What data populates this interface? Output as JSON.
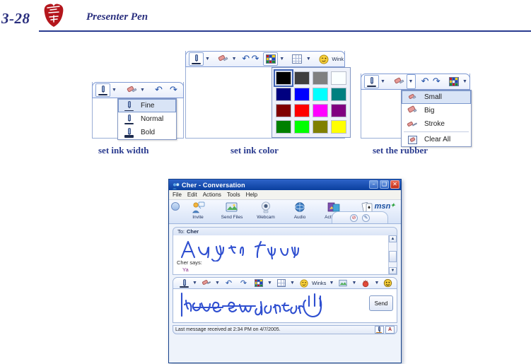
{
  "page": {
    "number": "3-28",
    "title": "Presenter Pen",
    "logo_icon": "red-seal-logo"
  },
  "captions": [
    {
      "text": "set ink width"
    },
    {
      "text": "set ink color"
    },
    {
      "text": "set the rubber"
    }
  ],
  "panel_ink_width": {
    "toolbar": [
      {
        "icon": "pen-icon",
        "selected": true
      },
      {
        "icon": "chevron-down-icon"
      },
      {
        "icon": "eraser-icon"
      },
      {
        "icon": "chevron-down-icon"
      },
      {
        "icon": "undo-icon"
      },
      {
        "icon": "redo-icon"
      }
    ],
    "menu": [
      {
        "label": "Fine",
        "icon": "pen-fine-icon",
        "highlighted": true
      },
      {
        "label": "Normal",
        "icon": "pen-normal-icon",
        "highlighted": false
      },
      {
        "label": "Bold",
        "icon": "pen-bold-icon",
        "highlighted": false
      }
    ]
  },
  "panel_ink_color": {
    "toolbar": [
      {
        "icon": "pen-icon",
        "selected": true
      },
      {
        "icon": "chevron-down-icon"
      },
      {
        "icon": "eraser-icon"
      },
      {
        "icon": "chevron-down-icon"
      },
      {
        "icon": "undo-icon"
      },
      {
        "icon": "redo-icon"
      },
      {
        "icon": "color-palette-icon",
        "selected": true
      },
      {
        "icon": "chevron-down-icon"
      },
      {
        "icon": "grid-icon"
      },
      {
        "icon": "chevron-down-icon"
      },
      {
        "icon": "wink-smiley-icon"
      }
    ],
    "wink_label": "Wink",
    "swatches": [
      {
        "name": "black",
        "hex": "#000000",
        "selected": true
      },
      {
        "name": "dark-gray",
        "hex": "#3f3f3f",
        "selected": false
      },
      {
        "name": "gray",
        "hex": "#808080",
        "selected": false
      },
      {
        "name": "white",
        "hex": "#fbffff",
        "selected": false
      },
      {
        "name": "navy",
        "hex": "#000080",
        "selected": false
      },
      {
        "name": "blue",
        "hex": "#0000ff",
        "selected": false
      },
      {
        "name": "cyan",
        "hex": "#00ffff",
        "selected": false
      },
      {
        "name": "teal",
        "hex": "#008080",
        "selected": false
      },
      {
        "name": "dark-red",
        "hex": "#800000",
        "selected": false
      },
      {
        "name": "red",
        "hex": "#ff0000",
        "selected": false
      },
      {
        "name": "magenta",
        "hex": "#ff00ff",
        "selected": false
      },
      {
        "name": "purple",
        "hex": "#800080",
        "selected": false
      },
      {
        "name": "green",
        "hex": "#008000",
        "selected": false
      },
      {
        "name": "lime",
        "hex": "#00ff00",
        "selected": false
      },
      {
        "name": "olive",
        "hex": "#808000",
        "selected": false
      },
      {
        "name": "yellow",
        "hex": "#ffff00",
        "selected": false
      }
    ]
  },
  "panel_rubber": {
    "toolbar": [
      {
        "icon": "pen-icon",
        "selected": true
      },
      {
        "icon": "chevron-down-icon"
      },
      {
        "icon": "eraser-icon"
      },
      {
        "icon": "chevron-down-icon",
        "selected": true
      },
      {
        "icon": "undo-icon"
      },
      {
        "icon": "redo-icon"
      },
      {
        "icon": "color-palette-icon"
      },
      {
        "icon": "chevron-down-icon"
      }
    ],
    "menu": [
      {
        "label": "Small",
        "icon": "eraser-small-icon",
        "highlighted": true
      },
      {
        "label": "Big",
        "icon": "eraser-big-icon",
        "highlighted": false
      },
      {
        "label": "Stroke",
        "icon": "eraser-stroke-icon",
        "highlighted": false
      },
      {
        "label": "Clear All",
        "icon": "clear-all-icon",
        "highlighted": false
      }
    ]
  },
  "messenger": {
    "title": "Cher - Conversation",
    "title_icon": "messenger-contact-icon",
    "window_buttons": [
      {
        "name": "minimize",
        "glyph": "–"
      },
      {
        "name": "maximize",
        "glyph": "❑"
      },
      {
        "name": "close",
        "glyph": "✕"
      }
    ],
    "menu": [
      "File",
      "Edit",
      "Actions",
      "Tools",
      "Help"
    ],
    "toolbar": [
      {
        "label": "Invite",
        "icon": "invite-icon"
      },
      {
        "label": "Send Files",
        "icon": "send-files-icon"
      },
      {
        "label": "Webcam",
        "icon": "webcam-icon"
      },
      {
        "label": "Audio",
        "icon": "audio-icon"
      },
      {
        "label": "Activities",
        "icon": "activities-icon"
      },
      {
        "label": "Games",
        "icon": "games-icon"
      }
    ],
    "brand": "msn",
    "tab_icons": [
      {
        "name": "block-icon",
        "glyph": "⊘"
      },
      {
        "name": "pen-tab-icon",
        "glyph": "✎"
      }
    ],
    "to_label": "To:",
    "to_value": "Cher",
    "history_ink_text": "Are You free",
    "says_name": "Cher says:",
    "says_text": "Ya",
    "format_toolbar": [
      {
        "icon": "pen-icon"
      },
      {
        "icon": "chevron-down-icon"
      },
      {
        "icon": "eraser-icon"
      },
      {
        "icon": "chevron-down-icon"
      },
      {
        "icon": "undo-icon"
      },
      {
        "icon": "redo-icon"
      },
      {
        "icon": "color-palette-icon"
      },
      {
        "icon": "chevron-down-icon"
      },
      {
        "icon": "grid-icon"
      },
      {
        "icon": "chevron-down-icon"
      },
      {
        "icon": "wink-smiley-icon"
      }
    ],
    "winks_label": "Winks",
    "compose_ink_text": "Have tea together",
    "compose_ink_drawing": "hand-wave-drawing",
    "send_label": "Send",
    "status_text": "Last message received at 2:34 PM on 4/7/2005.",
    "status_icons": [
      {
        "name": "handwriting-mode-icon",
        "glyph": "✐"
      },
      {
        "name": "text-mode-icon",
        "glyph": "A"
      }
    ]
  }
}
